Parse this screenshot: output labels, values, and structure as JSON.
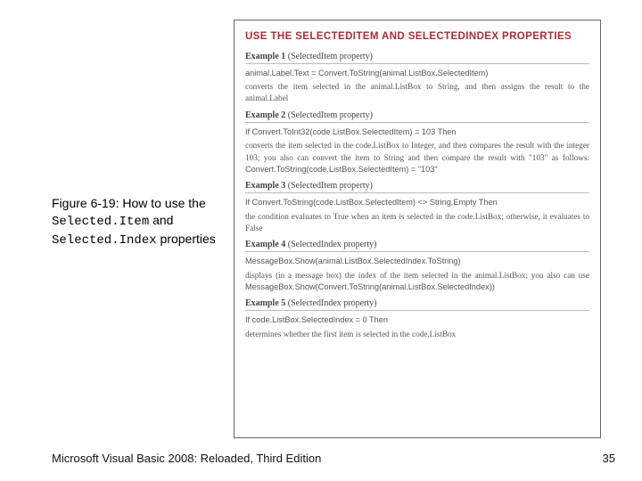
{
  "caption": {
    "prefix": "Figure 6-19: How to use the ",
    "code1": "Selected.Item",
    "mid": " and ",
    "code2": "Selected.Index",
    "suffix": " properties"
  },
  "figure": {
    "heading": "USE THE SELECTEDITEM AND SELECTEDINDEX PROPERTIES",
    "examples": [
      {
        "title_label": "Example 1",
        "title_note": "(SelectedItem property)",
        "code": "animal.Label.Text = Convert.ToString(animal.ListBox.SelectedItem)",
        "desc": "converts the item selected in the animal.ListBox to String, and then assigns the result to the animal.Label"
      },
      {
        "title_label": "Example 2",
        "title_note": "(SelectedItem property)",
        "code": "If Convert.ToInt32(code.ListBox.SelectedItem) = 103 Then",
        "desc": "converts the item selected in the code.ListBox to Integer, and then compares the result with the integer 103; you also can convert the item to String and then compare the result with \"103\" as follows: ",
        "inline_code": "Convert.ToString(code.ListBox.SelectedItem) = \"103\""
      },
      {
        "title_label": "Example 3",
        "title_note": "(SelectedItem property)",
        "code": "If Convert.ToString(code.ListBox.SelectedItem) <> String.Empty Then",
        "desc": "the condition evaluates to True when an item is selected in the code.ListBox; otherwise, it evaluates to False"
      },
      {
        "title_label": "Example 4",
        "title_note": "(SelectedIndex property)",
        "code": "MessageBox.Show(animal.ListBox.SelectedIndex.ToString)",
        "desc": "displays (in a message box) the index of the item selected in the animal.ListBox; you also can use ",
        "inline_code": "MessageBox.Show(Convert.ToString(animal.ListBox.SelectedIndex))"
      },
      {
        "title_label": "Example 5",
        "title_note": "(SelectedIndex property)",
        "code": "If code.ListBox.SelectedIndex = 0 Then",
        "desc": "determines whether the first item is selected in the code.ListBox"
      }
    ]
  },
  "footer": "Microsoft Visual Basic 2008: Reloaded, Third Edition",
  "page": "35"
}
